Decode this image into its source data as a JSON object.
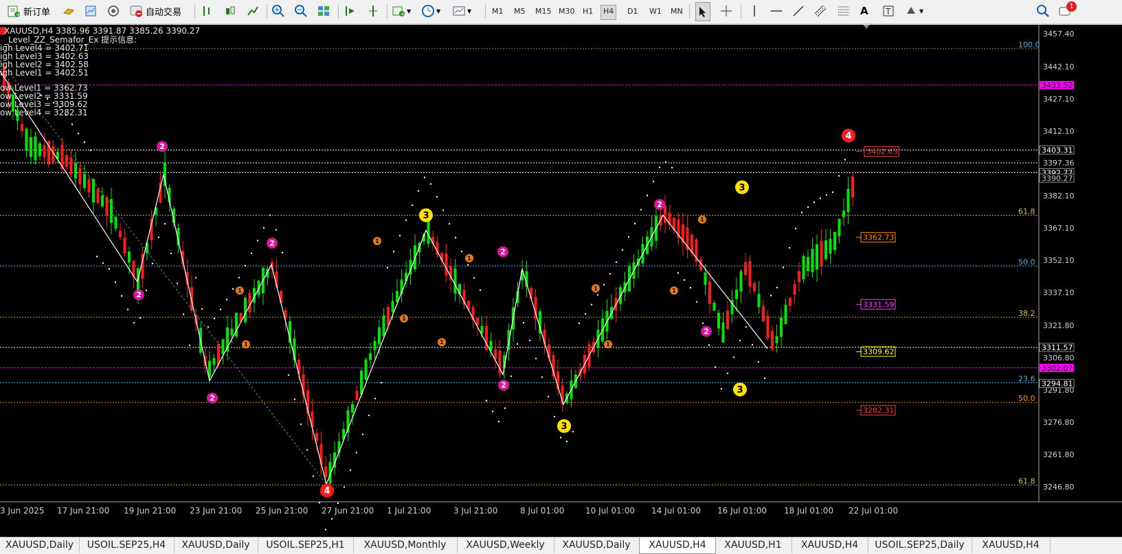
{
  "toolbar": {
    "new_order_label": "新订单",
    "auto_trading_label": "自动交易",
    "timeframes": [
      "M1",
      "M5",
      "M15",
      "M30",
      "H1",
      "H4",
      "D1",
      "W1",
      "MN"
    ],
    "active_timeframe": "H4",
    "notification_count": "1"
  },
  "chart": {
    "header": "XAUUSD,H4  3385.96 3391.87 3385.26 3390.27",
    "indicator_title": "_Level_ZZ_Semafor_Ex 提示信息:",
    "info_lines": [
      "igh Level4 = 3402.71",
      "igh Level3 = 3402.63",
      "igh Level2 = 3402.58",
      "igh Level1 = 3402.51",
      "ow Level1 = 3362.73",
      "ow Level2 = 3331.59",
      "ow Level3 = 3309.62",
      "ow Level4 = 3282.31"
    ],
    "price_axis": [
      "3457.40",
      "3442.10",
      "3427.10",
      "3412.10",
      "3397.36",
      "3382.10",
      "3367.10",
      "3352.10",
      "3337.10",
      "3321.80",
      "3306.80",
      "3291.80",
      "3276.80",
      "3261.80",
      "3246.80"
    ],
    "price_tags": [
      {
        "text": "3433.52",
        "color": "#ff00ff"
      },
      {
        "text": "3403.31",
        "color": "#ffffff"
      },
      {
        "text": "3392.77",
        "color": "#ffffff"
      },
      {
        "text": "3390.27",
        "color": "#c8c8c8"
      },
      {
        "text": "3311.57",
        "color": "#ffffff"
      },
      {
        "text": "3302.07",
        "color": "#ff00ff"
      },
      {
        "text": "3294.81",
        "color": "#ffffff"
      }
    ],
    "fib_labels": [
      {
        "text": "100.0",
        "color": "#4fb3d9"
      },
      {
        "text": "61.8",
        "color": "#d6c24a"
      },
      {
        "text": "50.0",
        "color": "#4fb3d9"
      },
      {
        "text": "38.2",
        "color": "#d6c24a"
      },
      {
        "text": "23.6",
        "color": "#4fb3d9"
      },
      {
        "text": "50.0",
        "color": "#ff9900"
      },
      {
        "text": "61.8",
        "color": "#d6c24a"
      }
    ],
    "level_boxes": [
      {
        "text": "3402.63",
        "color": "#ff3b3b"
      },
      {
        "text": "3362.73",
        "color": "#ff8c00"
      },
      {
        "text": "3331.59",
        "color": "#ff40ff"
      },
      {
        "text": "3309.62",
        "color": "#ffff00"
      },
      {
        "text": "3282.31",
        "color": "#ff3b3b"
      }
    ],
    "time_axis": [
      "3 Jun 2025",
      "17 Jun 21:00",
      "19 Jun 21:00",
      "23 Jun 21:00",
      "25 Jun 21:00",
      "27 Jun 21:00",
      "1 Jul 21:00",
      "3 Jul 21:00",
      "8 Jul 01:00",
      "10 Jul 01:00",
      "14 Jul 01:00",
      "16 Jul 01:00",
      "18 Jul 01:00",
      "22 Jul 01:00"
    ],
    "semafor_markers": [
      {
        "n": "2",
        "color": "#d4179b"
      },
      {
        "n": "2",
        "color": "#d4179b"
      },
      {
        "n": "2",
        "color": "#d4179b"
      },
      {
        "n": "2",
        "color": "#d4179b"
      },
      {
        "n": "2",
        "color": "#d4179b"
      },
      {
        "n": "2",
        "color": "#d4179b"
      },
      {
        "n": "2",
        "color": "#d4179b"
      },
      {
        "n": "2",
        "color": "#d4179b"
      },
      {
        "n": "3",
        "color": "#ffe000"
      },
      {
        "n": "3",
        "color": "#ffe000"
      },
      {
        "n": "3",
        "color": "#ffe000"
      },
      {
        "n": "3",
        "color": "#ffe000"
      },
      {
        "n": "4",
        "color": "#ff1a1a"
      },
      {
        "n": "4",
        "color": "#ff1a1a"
      },
      {
        "n": "1",
        "color": "#e07b1a"
      },
      {
        "n": "1",
        "color": "#e07b1a"
      },
      {
        "n": "1",
        "color": "#e07b1a"
      },
      {
        "n": "1",
        "color": "#e07b1a"
      },
      {
        "n": "1",
        "color": "#e07b1a"
      },
      {
        "n": "1",
        "color": "#e07b1a"
      },
      {
        "n": "1",
        "color": "#e07b1a"
      },
      {
        "n": "1",
        "color": "#e07b1a"
      },
      {
        "n": "1",
        "color": "#e07b1a"
      },
      {
        "n": "1",
        "color": "#e07b1a"
      }
    ],
    "colors": {
      "bull": "#00e600",
      "bear": "#ff1a1a",
      "zigzag": "#ffffff",
      "background": "#000000"
    }
  },
  "tabs": [
    "XAUUSD,Daily",
    "USOIL.SEP25,H4",
    "XAUUSD,Daily",
    "USOIL.SEP25,H1",
    "XAUUSD,Monthly",
    "XAUUSD,Weekly",
    "XAUUSD,Daily",
    "XAUUSD,H4",
    "XAUUSD,H1",
    "XAUUSD,H4",
    "USOIL.SEP25,Daily",
    "XAUUSD,H4"
  ],
  "active_tab_index": 7
}
